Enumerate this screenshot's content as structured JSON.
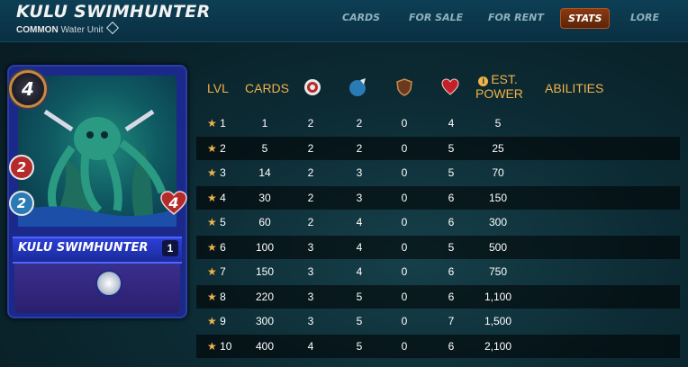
{
  "header": {
    "title": "KULU SWIMHUNTER",
    "rarity": "COMMON",
    "unit_type": "Water Unit",
    "nav": [
      "CARDS",
      "FOR SALE",
      "FOR RENT",
      "STATS",
      "LORE"
    ],
    "active_tab": "STATS"
  },
  "card": {
    "name": "KULU SWIMHUNTER",
    "mana": "4",
    "attack": "2",
    "speed": "2",
    "health": "4",
    "level": "1",
    "element_color": "#1b2a8a"
  },
  "table": {
    "headers": {
      "lvl": "LVL",
      "cards": "CARDS",
      "attack": "ranged-attack-icon",
      "speed": "speed-icon",
      "armor": "armor-icon",
      "health": "health-icon",
      "power_line1": "EST.",
      "power_line2": "POWER",
      "abilities": "ABILITIES"
    },
    "rows": [
      {
        "lvl": "1",
        "cards": "1",
        "attack": "2",
        "speed": "2",
        "armor": "0",
        "health": "4",
        "power": "5"
      },
      {
        "lvl": "2",
        "cards": "5",
        "attack": "2",
        "speed": "2",
        "armor": "0",
        "health": "5",
        "power": "25"
      },
      {
        "lvl": "3",
        "cards": "14",
        "attack": "2",
        "speed": "3",
        "armor": "0",
        "health": "5",
        "power": "70"
      },
      {
        "lvl": "4",
        "cards": "30",
        "attack": "2",
        "speed": "3",
        "armor": "0",
        "health": "6",
        "power": "150"
      },
      {
        "lvl": "5",
        "cards": "60",
        "attack": "2",
        "speed": "4",
        "armor": "0",
        "health": "6",
        "power": "300"
      },
      {
        "lvl": "6",
        "cards": "100",
        "attack": "3",
        "speed": "4",
        "armor": "0",
        "health": "5",
        "power": "500"
      },
      {
        "lvl": "7",
        "cards": "150",
        "attack": "3",
        "speed": "4",
        "armor": "0",
        "health": "6",
        "power": "750"
      },
      {
        "lvl": "8",
        "cards": "220",
        "attack": "3",
        "speed": "5",
        "armor": "0",
        "health": "6",
        "power": "1,100"
      },
      {
        "lvl": "9",
        "cards": "300",
        "attack": "3",
        "speed": "5",
        "armor": "0",
        "health": "7",
        "power": "1,500"
      },
      {
        "lvl": "10",
        "cards": "400",
        "attack": "4",
        "speed": "5",
        "armor": "0",
        "health": "6",
        "power": "2,100"
      }
    ]
  },
  "colors": {
    "accent": "#f0b24a",
    "active_tab": "#8a3a12",
    "header_bg": "#0d3f55"
  }
}
